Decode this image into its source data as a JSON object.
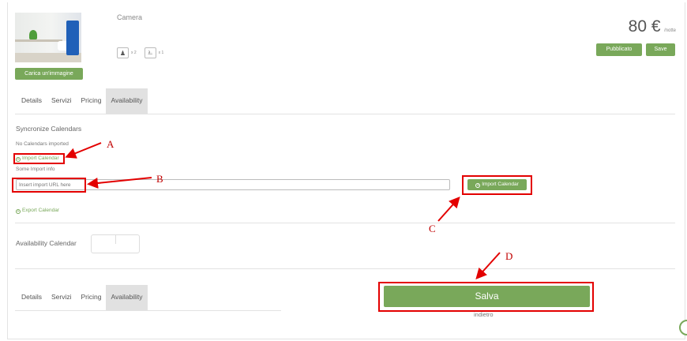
{
  "room": {
    "title": "Camera",
    "upload_label": "Carica un'immagine",
    "guests": [
      {
        "icon": "person-icon",
        "glyph": "♟",
        "count": "x 2"
      },
      {
        "icon": "bed-icon",
        "glyph": "⎁",
        "count": "x 1"
      }
    ],
    "price_amount": "80 €",
    "price_unit": "/notte",
    "published_label": "Pubblicato",
    "save_label": "Save"
  },
  "tabs": [
    {
      "label": "Details"
    },
    {
      "label": "Servizi"
    },
    {
      "label": "Pricing"
    },
    {
      "label": "Availability",
      "active": true
    }
  ],
  "sync": {
    "title": "Syncronize Calendars",
    "no_calendars": "No Calendars imported",
    "import_link": "Import Calendar",
    "import_info": "Some Import info",
    "url_placeholder": "Insert import URL here",
    "import_button": "Import Calendar",
    "export_link": "Export Calendar"
  },
  "availability": {
    "label": "Availability Calendar"
  },
  "footer": {
    "save_button": "Salva",
    "back_link": "indietro"
  },
  "annotations": {
    "a": "A",
    "b": "B",
    "c": "C",
    "d": "D",
    "color": "#e30000"
  },
  "colors": {
    "accent": "#79a85a",
    "active_tab": "#e1e1e1"
  }
}
